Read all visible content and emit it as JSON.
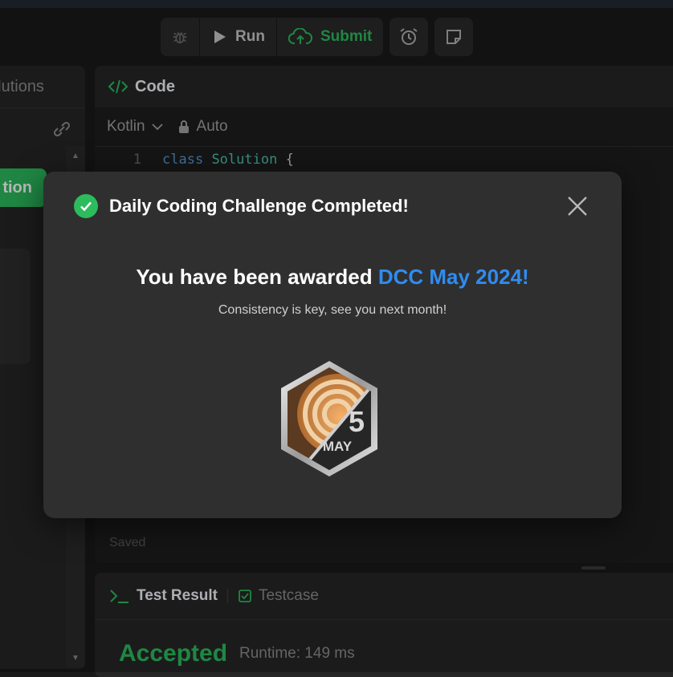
{
  "toolbar": {
    "run_label": "Run",
    "submit_label": "Submit"
  },
  "left_panel": {
    "tab_label": "olutions",
    "solution_button": "tion"
  },
  "code_panel": {
    "title": "Code",
    "language": "Kotlin",
    "mode": "Auto",
    "code_lines": [
      {
        "number": "1",
        "keyword": "class",
        "name": "Solution",
        "rest": " {"
      }
    ],
    "status": "Saved"
  },
  "test_panel": {
    "tab_result": "Test Result",
    "tab_testcase": "Testcase",
    "verdict": "Accepted",
    "runtime": "Runtime: 149 ms"
  },
  "modal": {
    "title": "Daily Coding Challenge Completed!",
    "award_prefix": "You have been awarded ",
    "award_name": "DCC May 2024!",
    "subtitle": "Consistency is key, see you next month!",
    "badge_day": "5",
    "badge_month": "MAY"
  },
  "colors": {
    "accent_green": "#2cbb5d",
    "accent_blue": "#2f8cf0",
    "modal_bg": "#2f2f2f"
  }
}
